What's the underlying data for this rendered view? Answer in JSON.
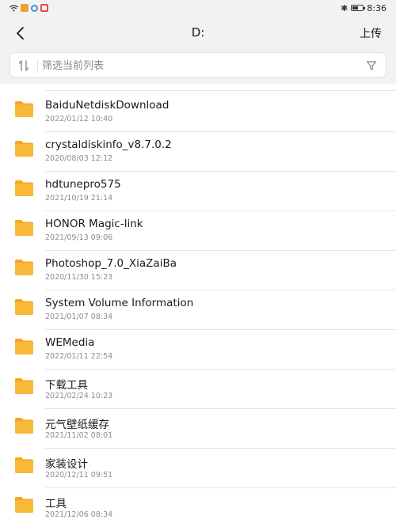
{
  "status_bar": {
    "time": "8:36",
    "left_icons": [
      "wifi-icon",
      "orange-app-icon",
      "blue-app-icon",
      "red-app-icon"
    ],
    "right_icons": [
      "bluetooth-icon",
      "battery-icon"
    ],
    "battery_level": 0.55
  },
  "header": {
    "title": "D:",
    "upload_label": "上传"
  },
  "filter": {
    "placeholder": "筛选当前列表"
  },
  "colors": {
    "folder": "#F8B838",
    "folder_tab": "#F5A623",
    "background": "#F2F2F2"
  },
  "files": [
    {
      "name": "BaiduNetdiskDownload",
      "date": "2022/01/12 10:40"
    },
    {
      "name": "crystaldiskinfo_v8.7.0.2",
      "date": "2020/08/03 12:12"
    },
    {
      "name": "hdtunepro575",
      "date": "2021/10/19 21:14"
    },
    {
      "name": "HONOR Magic-link",
      "date": "2021/09/13 09:06"
    },
    {
      "name": "Photoshop_7.0_XiaZaiBa",
      "date": "2020/11/30 15:23"
    },
    {
      "name": "System Volume Information",
      "date": "2021/01/07 08:34"
    },
    {
      "name": "WEMedia",
      "date": "2022/01/11 22:54"
    },
    {
      "name": "下载工具",
      "date": "2021/02/24 10:23"
    },
    {
      "name": "元气壁纸缓存",
      "date": "2021/11/02 08:01"
    },
    {
      "name": "家装设计",
      "date": "2020/12/11 09:51"
    },
    {
      "name": "工具",
      "date": "2021/12/06 08:34"
    }
  ]
}
